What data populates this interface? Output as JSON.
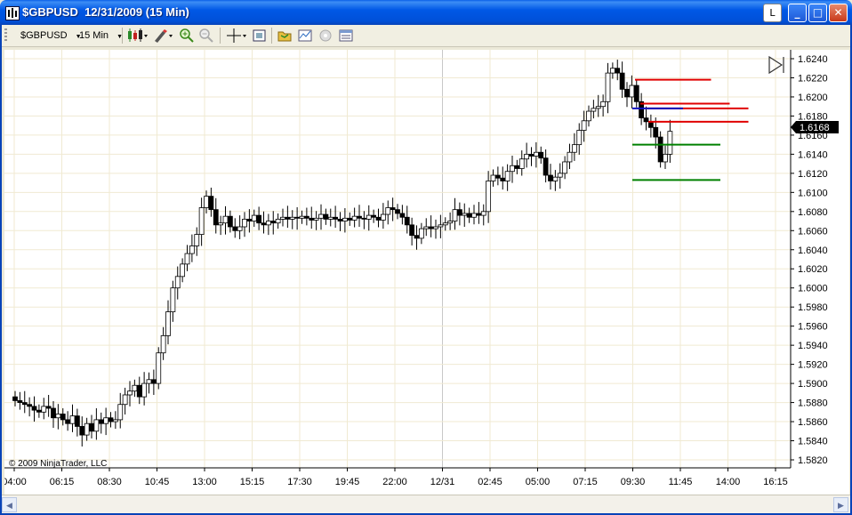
{
  "window": {
    "title": "$GBPUSD  12/31/2009 (15 Min)",
    "min_label": "L",
    "btn_minimize": "_",
    "btn_maximize": "□",
    "btn_close": "✕"
  },
  "toolbar": {
    "instrument": "$GBPUSD",
    "interval": "15 Min",
    "icons": [
      "candlestick-style-icon",
      "drawing-pencil-icon",
      "zoom-in-icon",
      "zoom-out-icon",
      "crosshair-icon",
      "snapshot-icon",
      "open-folder-icon",
      "indicators-icon",
      "strategies-icon",
      "data-box-icon"
    ]
  },
  "chart_data": {
    "type": "candlestick",
    "title": "",
    "xlabel": "",
    "ylabel": "",
    "x_ticks": [
      "04:00",
      "06:15",
      "08:30",
      "10:45",
      "13:00",
      "15:15",
      "17:30",
      "19:45",
      "22:00",
      "12/31",
      "02:45",
      "05:00",
      "07:15",
      "09:30",
      "11:45",
      "14:00",
      "16:15"
    ],
    "y_ticks": [
      "1.6240",
      "1.6220",
      "1.6200",
      "1.6180",
      "1.6160",
      "1.6140",
      "1.6120",
      "1.6100",
      "1.6080",
      "1.6060",
      "1.6040",
      "1.6020",
      "1.6000",
      "1.5980",
      "1.5960",
      "1.5940",
      "1.5920",
      "1.5900",
      "1.5880",
      "1.5860",
      "1.5840",
      "1.5820"
    ],
    "ylim": [
      1.5815,
      1.6248
    ],
    "last_price": "1.6168",
    "last_price_raw": 1.61683,
    "copyright": "© 2009 NinjaTrader, LLC",
    "grid": true,
    "bull_color": "#FFFFFF",
    "bear_color": "#000000",
    "closes": [
      1.5882,
      1.588,
      1.5878,
      1.5876,
      1.5872,
      1.587,
      1.5876,
      1.5874,
      1.5864,
      1.5868,
      1.5862,
      1.5858,
      1.5866,
      1.5855,
      1.5846,
      1.5858,
      1.585,
      1.5862,
      1.5858,
      1.5864,
      1.586,
      1.5862,
      1.5878,
      1.5888,
      1.5892,
      1.5898,
      1.5886,
      1.59,
      1.5904,
      1.59,
      1.5932,
      1.595,
      1.5975,
      1.6,
      1.6012,
      1.6025,
      1.6036,
      1.6044,
      1.6056,
      1.6084,
      1.6096,
      1.6082,
      1.6066,
      1.6068,
      1.6075,
      1.6064,
      1.606,
      1.6064,
      1.6072,
      1.607,
      1.6076,
      1.6068,
      1.6066,
      1.607,
      1.6068,
      1.6072,
      1.6074,
      1.6072,
      1.6074,
      1.6073,
      1.6075,
      1.6073,
      1.6071,
      1.6073,
      1.6077,
      1.6072,
      1.6074,
      1.6072,
      1.607,
      1.6073,
      1.6071,
      1.6075,
      1.6073,
      1.6072,
      1.6076,
      1.6074,
      1.6071,
      1.6077,
      1.6084,
      1.6082,
      1.6078,
      1.6074,
      1.6066,
      1.6055,
      1.6052,
      1.6062,
      1.6064,
      1.6062,
      1.6064,
      1.6066,
      1.6068,
      1.607,
      1.6082,
      1.6076,
      1.6078,
      1.6074,
      1.6078,
      1.6076,
      1.608,
      1.6112,
      1.6118,
      1.6115,
      1.6112,
      1.6122,
      1.6128,
      1.6125,
      1.6135,
      1.614,
      1.6138,
      1.6142,
      1.6136,
      1.6118,
      1.6112,
      1.6116,
      1.612,
      1.6132,
      1.6142,
      1.615,
      1.6165,
      1.6175,
      1.6185,
      1.6188,
      1.619,
      1.6195,
      1.6225,
      1.623,
      1.6225,
      1.6208,
      1.62,
      1.6212,
      1.6195,
      1.6178,
      1.6174,
      1.6168,
      1.6158,
      1.6132,
      1.614,
      1.6164
    ],
    "levels": [
      {
        "price": 1.6218,
        "color": "#E00000",
        "from": 1.73,
        "to": 1.79
      },
      {
        "price": 1.6193,
        "color": "#E00000",
        "from": 1.75,
        "to": 1.81
      },
      {
        "price": 1.6188,
        "color": "#E00000",
        "from": 1.77,
        "to": 1.83
      },
      {
        "price": 1.6174,
        "color": "#E00000",
        "from": 1.78,
        "to": 1.83
      },
      {
        "price": 1.6188,
        "color": "#1010C0",
        "from": 1.72,
        "to": 1.76
      },
      {
        "price": 1.615,
        "color": "#008000",
        "from": 1.72,
        "to": 1.8
      },
      {
        "price": 1.6113,
        "color": "#008000",
        "from": 1.72,
        "to": 1.8
      }
    ]
  }
}
